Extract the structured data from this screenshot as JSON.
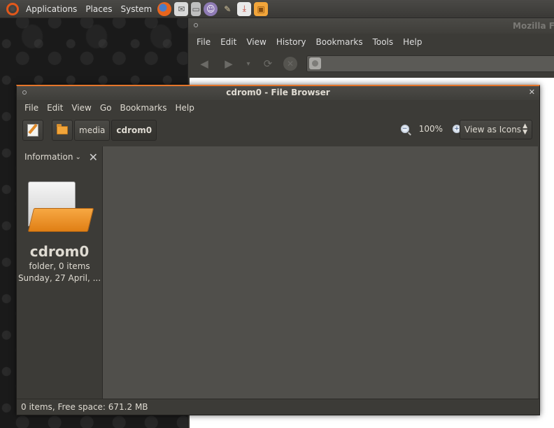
{
  "top_panel": {
    "menus": [
      "Applications",
      "Places",
      "System"
    ],
    "launchers": [
      "firefox-icon",
      "mail-icon",
      "notes-icon",
      "pidgin-icon",
      "gimp-icon",
      "download-icon",
      "folder-icon"
    ]
  },
  "firefox": {
    "title": "Mozilla F",
    "menus": [
      "File",
      "Edit",
      "View",
      "History",
      "Bookmarks",
      "Tools",
      "Help"
    ]
  },
  "file_browser": {
    "title": "cdrom0 - File Browser",
    "menus": [
      "File",
      "Edit",
      "View",
      "Go",
      "Bookmarks",
      "Help"
    ],
    "breadcrumbs": [
      "media",
      "cdrom0"
    ],
    "zoom_level": "100%",
    "view_mode": "View as Icons",
    "sidepane": {
      "header": "Information",
      "name": "cdrom0",
      "type": "folder, 0 items",
      "date": "Sunday, 27 April, ..."
    },
    "status": "0 items, Free space: 671.2 MB"
  },
  "colors": {
    "accent": "#e6762a",
    "window_bg": "#3c3b37",
    "content_bg": "#504f4b"
  }
}
